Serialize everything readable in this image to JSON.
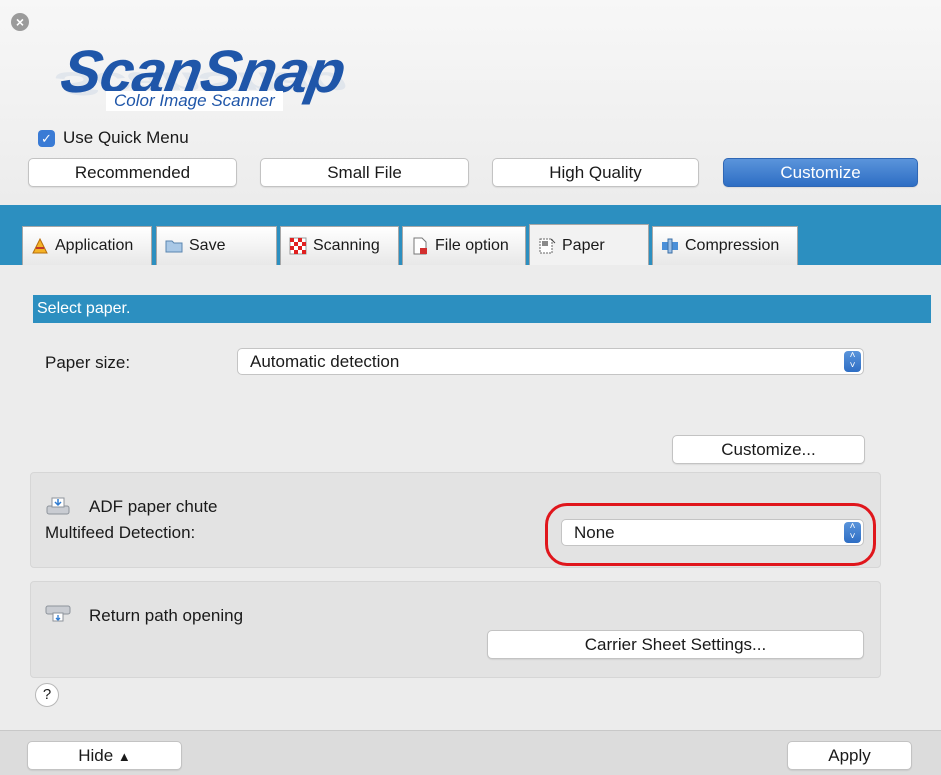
{
  "header": {
    "logo_main": "ScanSnap",
    "logo_sub": "Color Image Scanner",
    "quick_menu_label": "Use Quick Menu",
    "quick_menu_checked": true,
    "modes": [
      "Recommended",
      "Small File",
      "High Quality",
      "Customize"
    ],
    "active_mode": "Customize"
  },
  "tabs": [
    {
      "label": "Application",
      "icon": "application-icon"
    },
    {
      "label": "Save",
      "icon": "folder-icon"
    },
    {
      "label": "Scanning",
      "icon": "checker-icon"
    },
    {
      "label": "File option",
      "icon": "document-icon"
    },
    {
      "label": "Paper",
      "icon": "paper-icon"
    },
    {
      "label": "Compression",
      "icon": "compression-icon"
    }
  ],
  "selected_tab": "Paper",
  "paper": {
    "section_title": "Select paper.",
    "size_label": "Paper size:",
    "size_value": "Automatic detection",
    "customize_label": "Customize...",
    "adf_title": "ADF paper chute",
    "multifeed_label": "Multifeed Detection:",
    "multifeed_value": "None",
    "return_title": "Return path opening",
    "carrier_label": "Carrier Sheet Settings..."
  },
  "help_label": "?",
  "footer": {
    "hide_label": "Hide",
    "hide_icon": "chevron-up-icon",
    "apply_label": "Apply"
  },
  "colors": {
    "accent_blue": "#2c8fc0",
    "button_blue": "#3a7bd5",
    "logo_blue": "#1f56a9",
    "highlight_red": "#e0161c"
  }
}
